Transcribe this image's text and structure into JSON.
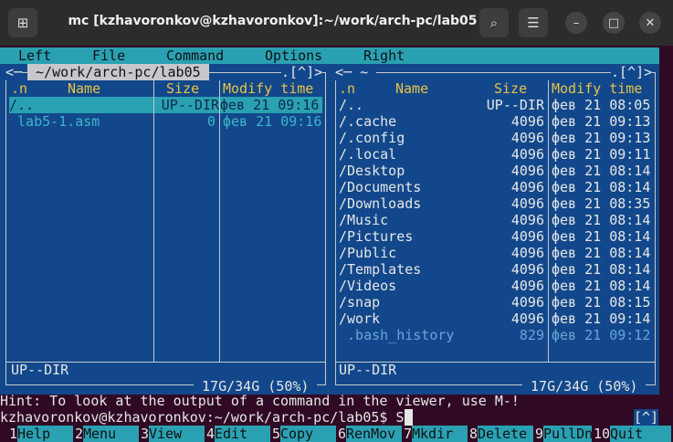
{
  "window": {
    "title": "mc [kzhavoronkov@kzhavoronkov]:~/work/arch-pc/lab05",
    "new_tab_icon": "new-tab-icon",
    "search_icon": "search-icon",
    "menu_icon": "hamburger-menu-icon",
    "minimize_icon": "minimize-icon",
    "maximize_icon": "maximize-icon",
    "close_icon": "close-icon"
  },
  "menubar": [
    "Left",
    "File",
    "Command",
    "Options",
    "Right"
  ],
  "left_panel": {
    "corner_left": "<─",
    "path": " ~/work/arch-pc/lab05 ",
    "corner_right": ".[^]>",
    "headers": {
      "n": ".n",
      "name": "Name",
      "size": "Size",
      "mtime": "Modify time"
    },
    "files": [
      {
        "name": "/..",
        "size": "UP--DIR",
        "mtime": "фев 21 09:16",
        "selected": true
      },
      {
        "name": " lab5-1.asm",
        "size": "0",
        "mtime": "фев 21 09:16",
        "selected": false
      }
    ],
    "status": "UP--DIR",
    "disk": " 17G/34G (50%) "
  },
  "right_panel": {
    "corner_left": "<─ ~ ",
    "corner_right": ".[^]>",
    "headers": {
      "n": ".n",
      "name": "Name",
      "size": "Size",
      "mtime": "Modify time"
    },
    "files": [
      {
        "name": "/..",
        "size": "UP--DIR",
        "mtime": "фев 21 08:05"
      },
      {
        "name": "/.cache",
        "size": "4096",
        "mtime": "фев 21 09:13"
      },
      {
        "name": "/.config",
        "size": "4096",
        "mtime": "фев 21 09:13"
      },
      {
        "name": "/.local",
        "size": "4096",
        "mtime": "фев 21 09:11"
      },
      {
        "name": "/Desktop",
        "size": "4096",
        "mtime": "фев 21 08:14"
      },
      {
        "name": "/Documents",
        "size": "4096",
        "mtime": "фев 21 08:14"
      },
      {
        "name": "/Downloads",
        "size": "4096",
        "mtime": "фев 21 08:35"
      },
      {
        "name": "/Music",
        "size": "4096",
        "mtime": "фев 21 08:14"
      },
      {
        "name": "/Pictures",
        "size": "4096",
        "mtime": "фев 21 08:14"
      },
      {
        "name": "/Public",
        "size": "4096",
        "mtime": "фев 21 08:14"
      },
      {
        "name": "/Templates",
        "size": "4096",
        "mtime": "фев 21 08:14"
      },
      {
        "name": "/Videos",
        "size": "4096",
        "mtime": "фев 21 08:14"
      },
      {
        "name": "/snap",
        "size": "4096",
        "mtime": "фев 21 08:15"
      },
      {
        "name": "/work",
        "size": "4096",
        "mtime": "фев 21 09:14"
      },
      {
        "name": " .bash_history",
        "size": "829",
        "mtime": "фев 21 09:12"
      }
    ],
    "status": "UP--DIR",
    "disk": " 17G/34G (50%) "
  },
  "hint": "Hint: To look at the output of a command in the viewer, use M-!",
  "prompt": "kzhavoronkov@kzhavoronkov:~/work/arch-pc/lab05$ S",
  "prompt_corner": "[^]",
  "fkeys": [
    {
      "num": "1",
      "label": "Help"
    },
    {
      "num": "2",
      "label": "Menu"
    },
    {
      "num": "3",
      "label": "View"
    },
    {
      "num": "4",
      "label": "Edit"
    },
    {
      "num": "5",
      "label": "Copy"
    },
    {
      "num": "6",
      "label": "RenMov"
    },
    {
      "num": "7",
      "label": "Mkdir"
    },
    {
      "num": "8",
      "label": "Delete"
    },
    {
      "num": "9",
      "label": "PullDn"
    },
    {
      "num": "10",
      "label": "Quit"
    }
  ],
  "colors": {
    "panel_bg": "#12488b",
    "accent": "#2aa1b3",
    "header": "#e8c246",
    "terminal_bg": "#300a24"
  }
}
